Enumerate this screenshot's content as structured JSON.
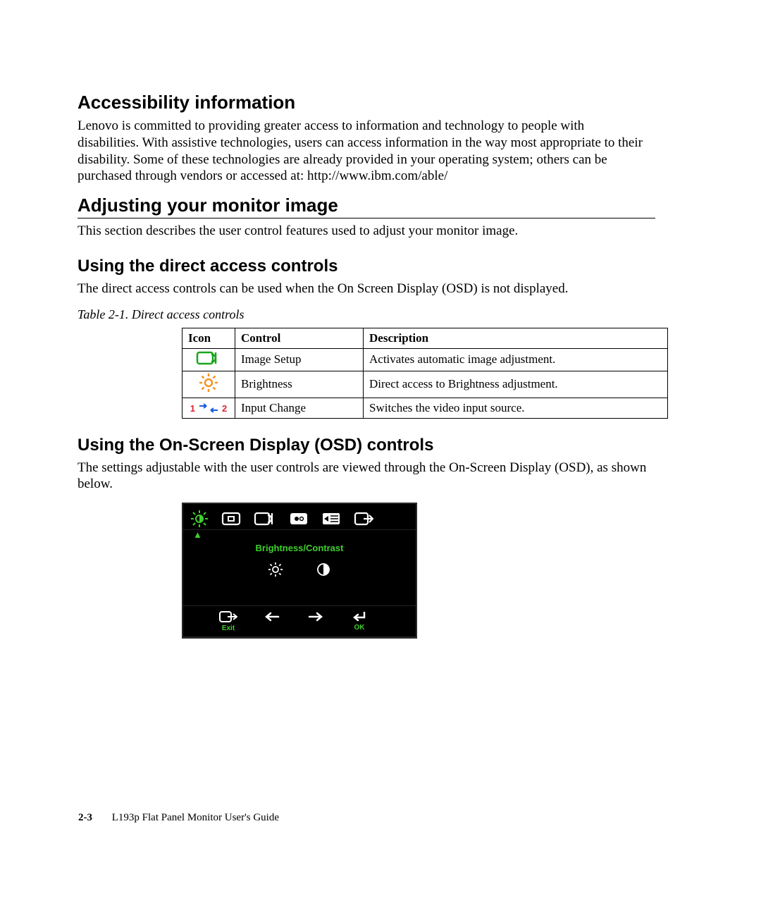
{
  "sections": {
    "accessibility": {
      "heading": "Accessibility information",
      "body": "Lenovo is committed to providing greater access to information and technology to people with disabilities. With assistive technologies, users can access information in the way most appropriate to their disability. Some of these technologies are already provided in your operating system; others can be purchased through vendors or accessed at: http://www.ibm.com/able/"
    },
    "adjusting": {
      "heading": "Adjusting your monitor image",
      "body": "This section describes the user control features used to adjust your monitor image."
    },
    "direct": {
      "heading": "Using the direct access controls",
      "body": "The direct access controls can be used when the On Screen Display (OSD) is not displayed.",
      "table_caption": "Table 2-1. Direct access controls",
      "table": {
        "headers": {
          "icon": "Icon",
          "control": "Control",
          "description": "Description"
        },
        "rows": [
          {
            "icon": "image-setup-icon",
            "control": "Image Setup",
            "description": "Activates automatic image adjustment."
          },
          {
            "icon": "brightness-icon",
            "control": "Brightness",
            "description": "Direct access to Brightness adjustment."
          },
          {
            "icon": "input-change-icon",
            "control": "Input Change",
            "description": "Switches the video input source."
          }
        ]
      }
    },
    "osd": {
      "heading": "Using the On-Screen Display (OSD) controls",
      "body": "The settings adjustable with the user controls are viewed through the On-Screen Display (OSD), as shown below.",
      "panel": {
        "title": "Brightness/Contrast",
        "top_icons": [
          "brightness-contrast-icon",
          "image-position-icon",
          "image-setup-icon",
          "image-properties-icon",
          "options-icon",
          "exit-icon"
        ],
        "mid_icons": [
          "brightness-sub-icon",
          "contrast-sub-icon"
        ],
        "exit_label": "Exit",
        "ok_label": "OK"
      }
    }
  },
  "footer": {
    "page_number": "2-3",
    "doc_title": "L193p Flat Panel Monitor User's Guide"
  }
}
